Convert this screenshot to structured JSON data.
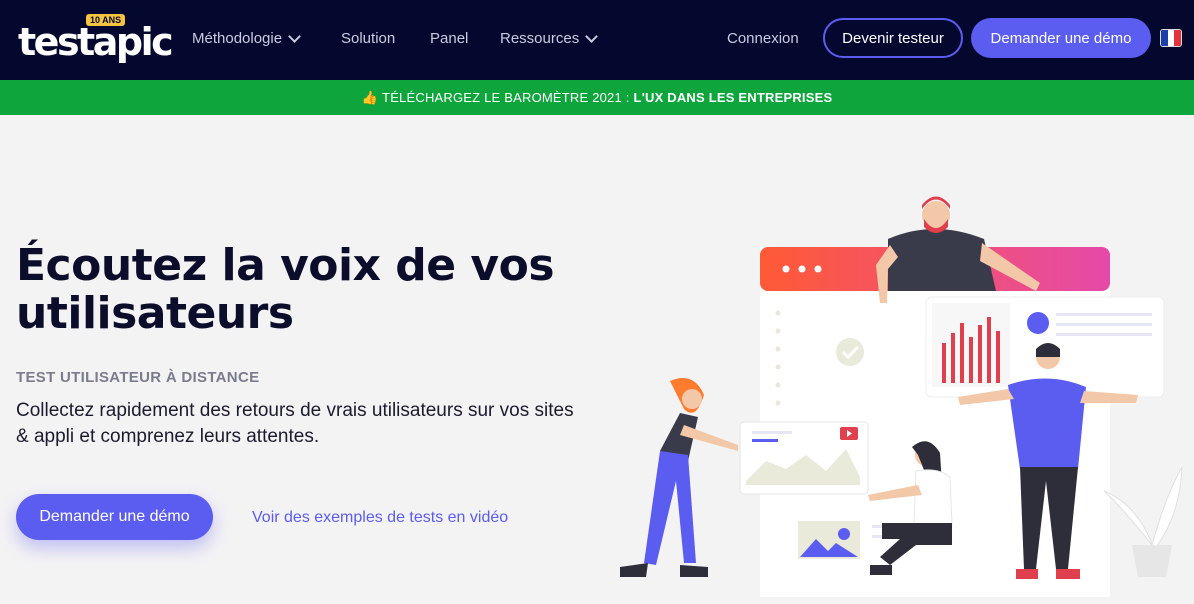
{
  "header": {
    "logo": {
      "text": "testapic",
      "badge": "10 ANS"
    },
    "nav": [
      {
        "label": "Méthodologie",
        "has_dropdown": true
      },
      {
        "label": "Solution",
        "has_dropdown": false
      },
      {
        "label": "Panel",
        "has_dropdown": false
      },
      {
        "label": "Ressources",
        "has_dropdown": true
      }
    ],
    "login_label": "Connexion",
    "tester_button": "Devenir testeur",
    "demo_button": "Demander une démo",
    "language": "fr"
  },
  "banner": {
    "icon": "thumbs-up-icon",
    "text_plain": "TÉLÉCHARGEZ LE BAROMÈTRE 2021 :",
    "text_bold": "L'UX DANS LES ENTREPRISES"
  },
  "hero": {
    "title": "Écoutez la voix de vos utilisateurs",
    "eyebrow": "TEST UTILISATEUR À DISTANCE",
    "lead": "Collectez rapidement des retours de vrais utilisateurs sur vos sites & appli et comprenez leurs attentes.",
    "cta_label": "Demander une démo",
    "video_link_label": "Voir des exemples de tests en vidéo"
  },
  "colors": {
    "nav_bg": "#05082e",
    "accent": "#5b5cf0",
    "banner_bg": "#0ea53c",
    "page_bg": "#f4f3f4"
  }
}
